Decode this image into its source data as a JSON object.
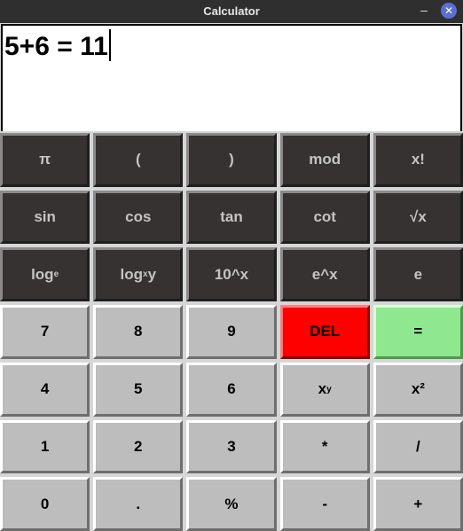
{
  "window": {
    "title": "Calculator",
    "minimize_glyph": "–",
    "close_glyph": "✕"
  },
  "display": {
    "expression": "5+6 = 11"
  },
  "keys": {
    "pi": "π",
    "lparen": "(",
    "rparen": ")",
    "mod": "mod",
    "factorial": "x!",
    "sin": "sin",
    "cos": "cos",
    "tan": "tan",
    "cot": "cot",
    "sqrt": "√x",
    "log_e_base": "log",
    "log_e_sub": "e",
    "log_xy_base": "log",
    "log_xy_sub": "x",
    "log_xy_tail": "y",
    "ten_pow_x": "10^x",
    "e_pow_x": "e^x",
    "e": "e",
    "seven": "7",
    "eight": "8",
    "nine": "9",
    "del": "DEL",
    "equals": "=",
    "four": "4",
    "five": "5",
    "six": "6",
    "x_pow_y_base": "x",
    "x_pow_y_sup": "y",
    "x_squared": "x²",
    "one": "1",
    "two": "2",
    "three": "3",
    "multiply": "*",
    "divide": "/",
    "zero": "0",
    "dot": ".",
    "percent": "%",
    "minus": "-",
    "plus": "+"
  },
  "colors": {
    "scientific_key_bg": "#363232",
    "numeric_key_bg": "#bdbdbd",
    "del_bg": "#ff0000",
    "equals_bg": "#8fe88f"
  }
}
